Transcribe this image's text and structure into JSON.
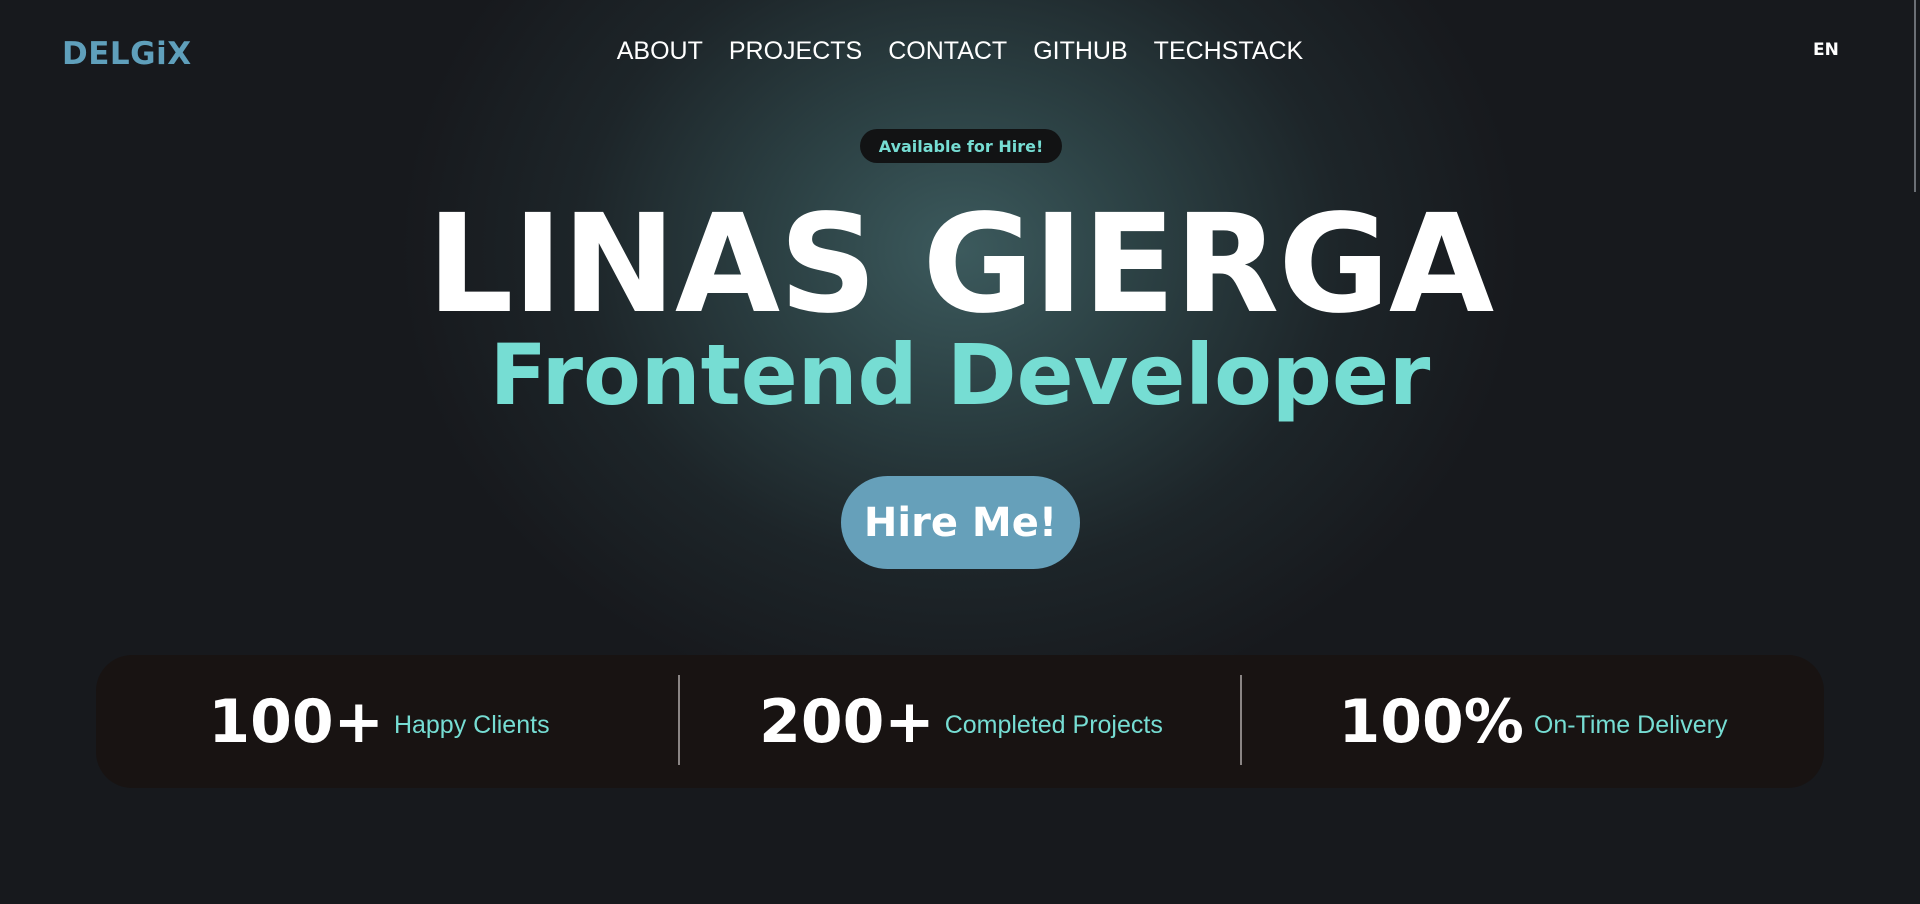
{
  "header": {
    "logo": "DELGiX",
    "nav": [
      "ABOUT",
      "PROJECTS",
      "CONTACT",
      "GITHUB",
      "TECHSTACK"
    ],
    "language": "EN"
  },
  "hero": {
    "badge": "Available for Hire!",
    "name": "LINAS GIERGA",
    "role": "Frontend Developer",
    "cta": "Hire Me!"
  },
  "stats": [
    {
      "value": "100+",
      "label": "Happy Clients"
    },
    {
      "value": "200+",
      "label": "Completed Projects"
    },
    {
      "value": "100%",
      "label": "On-Time Delivery"
    }
  ],
  "colors": {
    "accent": "#76ddd3",
    "brand": "#5f9fbb",
    "button": "#66a0ba",
    "background": "#17191d"
  }
}
